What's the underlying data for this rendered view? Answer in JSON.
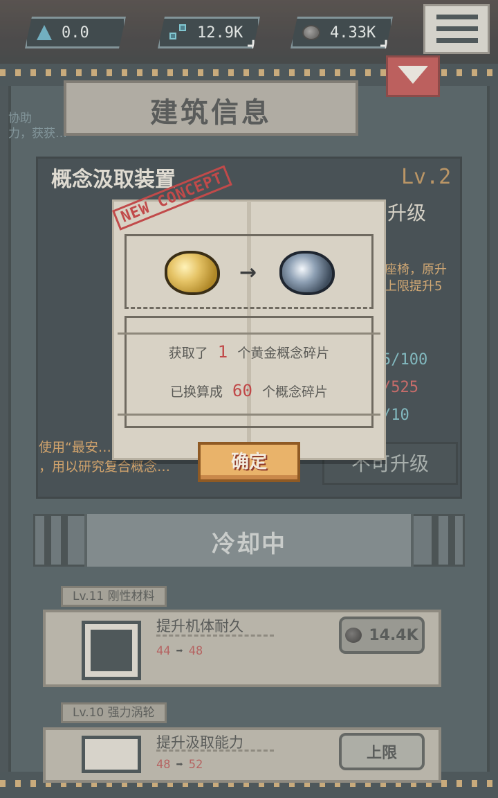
{
  "resources": [
    {
      "icon": "crystal-icon",
      "value": "0.0",
      "has_plus": false
    },
    {
      "icon": "nodes-icon",
      "value": "12.9K",
      "has_plus": true
    },
    {
      "icon": "ore-icon",
      "value": "4.33K",
      "has_plus": true
    }
  ],
  "panel": {
    "title": "建筑信息",
    "assist_text": "协助\n力，获获…",
    "building_name": "概念汲取装置",
    "building_level": "Lv.2",
    "upgrade_label": "升级",
    "upgrade_desc": "座椅，原升\n上限提升5",
    "stats": [
      "5/100",
      "/525",
      "/10"
    ],
    "cannot_upgrade": "不可升级",
    "description": "使用“最安…\n，用以研究复合概念…",
    "cooldown": "冷却中"
  },
  "cards": [
    {
      "tag": "Lv.11 刚性材料",
      "title": "提升机体耐久",
      "from": "44",
      "to": "48",
      "cost": "14.4K"
    },
    {
      "tag": "Lv.10 强力涡轮",
      "title": "提升汲取能力",
      "from": "48",
      "to": "52",
      "cost": "上限"
    }
  ],
  "modal": {
    "stamp": "NEW CONCEPT",
    "line1_prefix": "获取了",
    "line1_num": "1",
    "line1_suffix": "个黄金概念碎片",
    "line2_prefix": "已换算成",
    "line2_num": "60",
    "line2_suffix": "个概念碎片",
    "confirm": "确定"
  },
  "colors": {
    "accent_gold": "#e9b36a",
    "highlight_red": "#c04848",
    "level_orange": "#b8894f",
    "collapse_red": "#b94545"
  }
}
